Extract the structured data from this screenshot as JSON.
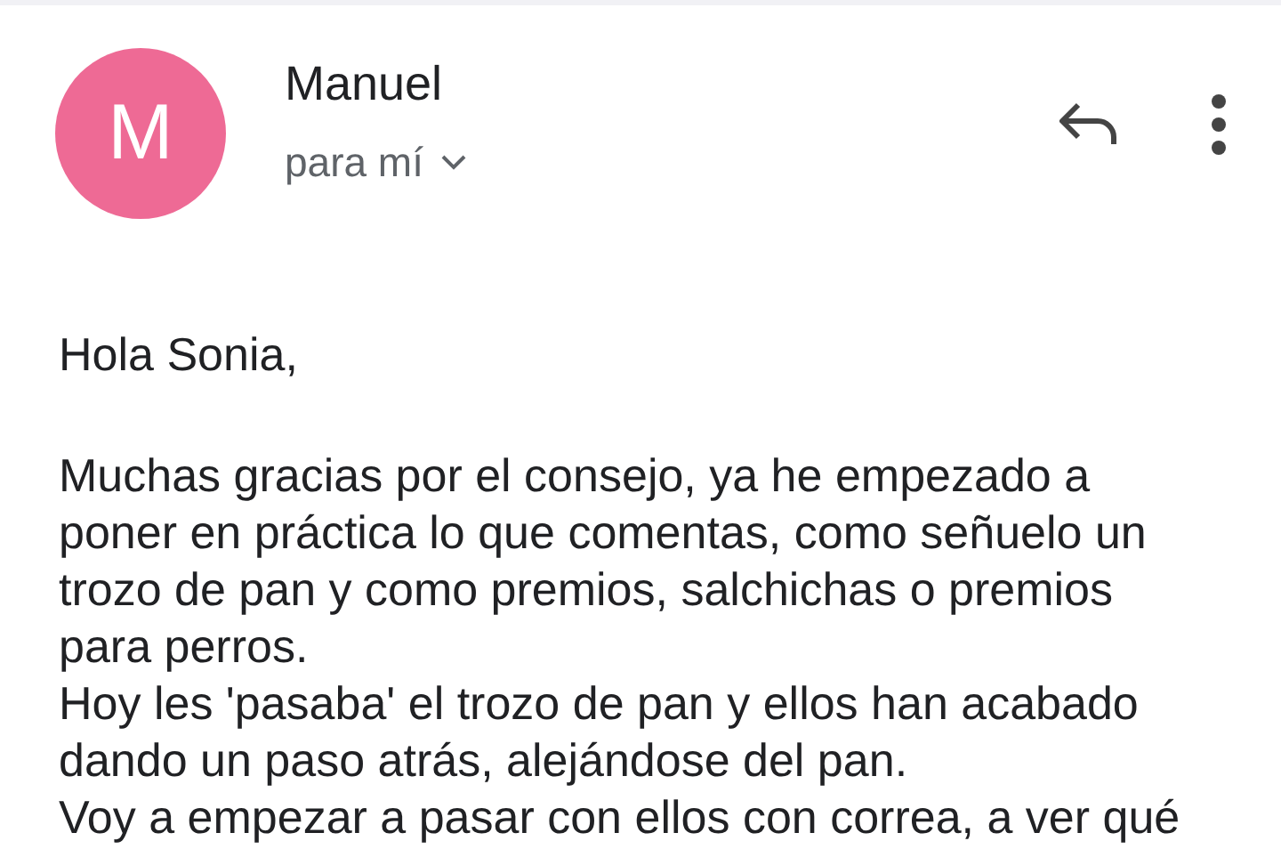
{
  "sender": {
    "avatar_letter": "M",
    "name": "Manuel",
    "recipient": "para mí"
  },
  "body": {
    "lines": [
      {
        "kind": "line",
        "text": "Hola Sonia,"
      },
      {
        "kind": "blank"
      },
      {
        "kind": "line",
        "text": "Muchas gracias por el consejo, ya he empezado a"
      },
      {
        "kind": "line",
        "text": "poner en práctica lo que comentas, como señuelo un"
      },
      {
        "kind": "line",
        "text": "trozo de pan y como premios, salchichas o premios"
      },
      {
        "kind": "line",
        "text": "para perros."
      },
      {
        "kind": "line",
        "text": "Hoy les 'pasaba' el trozo de pan y ellos han acabado"
      },
      {
        "kind": "line",
        "text": "dando un paso atrás, alejándose del pan."
      },
      {
        "kind": "line",
        "text": "Voy a empezar a pasar con ellos con correa, a ver qué"
      }
    ]
  }
}
